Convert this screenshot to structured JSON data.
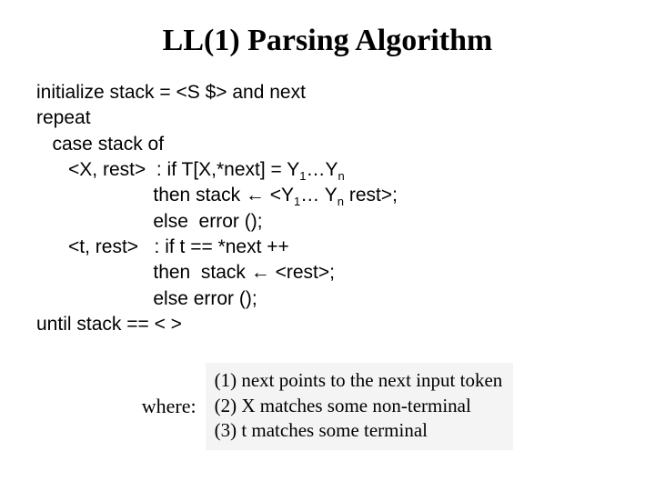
{
  "title": "LL(1) Parsing Algorithm",
  "algo": {
    "l1": "initialize stack = <S $> and next",
    "l2": "repeat",
    "l3": "   case stack of",
    "l4a": "      <X, rest>  : if T[X,*next] = Y",
    "l4b": "…Y",
    "l5a": "                      then stack ← <Y",
    "l5b": "… Y",
    "l5c": " rest>;",
    "l6": "                      else  error ();",
    "l7": "      <t, rest>   : if t == *next ++",
    "l8": "                      then  stack ← <rest>;",
    "l9": "                      else error ();",
    "l10": "until stack == < >",
    "sub1": "1",
    "subn": "n"
  },
  "where": {
    "label": "where:",
    "n1": "(1) next points to the next input token",
    "n2": "(2) X matches some non-terminal",
    "n3": "(3) t matches some terminal"
  }
}
